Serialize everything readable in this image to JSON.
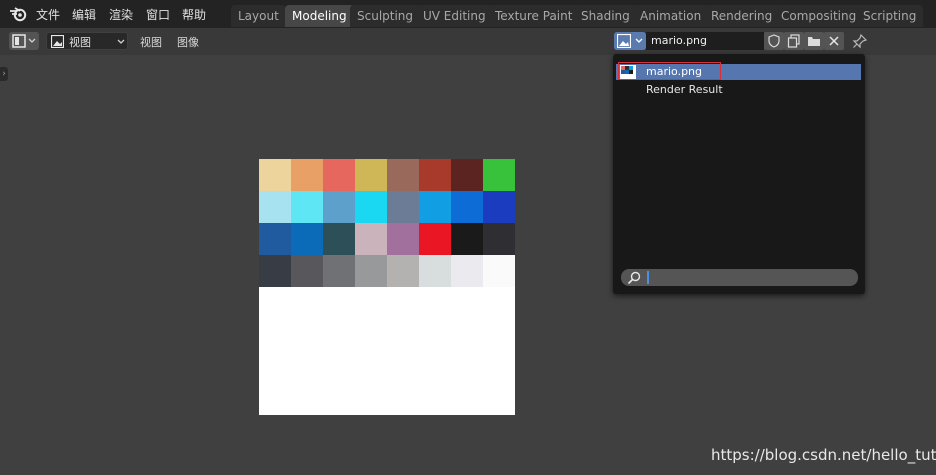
{
  "menu": [
    "文件",
    "编辑",
    "渲染",
    "窗口",
    "帮助"
  ],
  "workspace_tabs": [
    {
      "label": "Layout",
      "active": false
    },
    {
      "label": "Modeling",
      "active": true
    },
    {
      "label": "Sculpting",
      "active": false
    },
    {
      "label": "UV Editing",
      "active": false
    },
    {
      "label": "Texture Paint",
      "active": false
    },
    {
      "label": "Shading",
      "active": false
    },
    {
      "label": "Animation",
      "active": false
    },
    {
      "label": "Rendering",
      "active": false
    },
    {
      "label": "Compositing",
      "active": false
    },
    {
      "label": "Scripting",
      "active": false
    }
  ],
  "editor_header": {
    "view_mode": "视图",
    "menus": [
      "视图",
      "图像"
    ]
  },
  "image_selector": {
    "current_image": "mario.png"
  },
  "image_browser": {
    "items": [
      {
        "label": "mario.png",
        "selected": true
      },
      {
        "label": "Render Result",
        "selected": false
      }
    ],
    "search_value": ""
  },
  "palette_colors": [
    "#ecd49c",
    "#e8a067",
    "#e5675d",
    "#cfb657",
    "#996a5c",
    "#a83a2c",
    "#5b2420",
    "#38c23c",
    "#a6e2f0",
    "#5ee6f4",
    "#5ea0cc",
    "#1ad8f1",
    "#6c7b96",
    "#129ee2",
    "#0e6cd6",
    "#1c3cc0",
    "#1f5b9e",
    "#0b6bb8",
    "#2d5058",
    "#cbb3bc",
    "#a1709c",
    "#ea1624",
    "#1a1a1a",
    "#2f2f33",
    "#383c45",
    "#58585c",
    "#707174",
    "#98999b",
    "#b4b1b1",
    "#d8dedd",
    "#ebebef",
    "#fafafa"
  ],
  "watermark": "https://blog.csdn.net/hello_tute"
}
